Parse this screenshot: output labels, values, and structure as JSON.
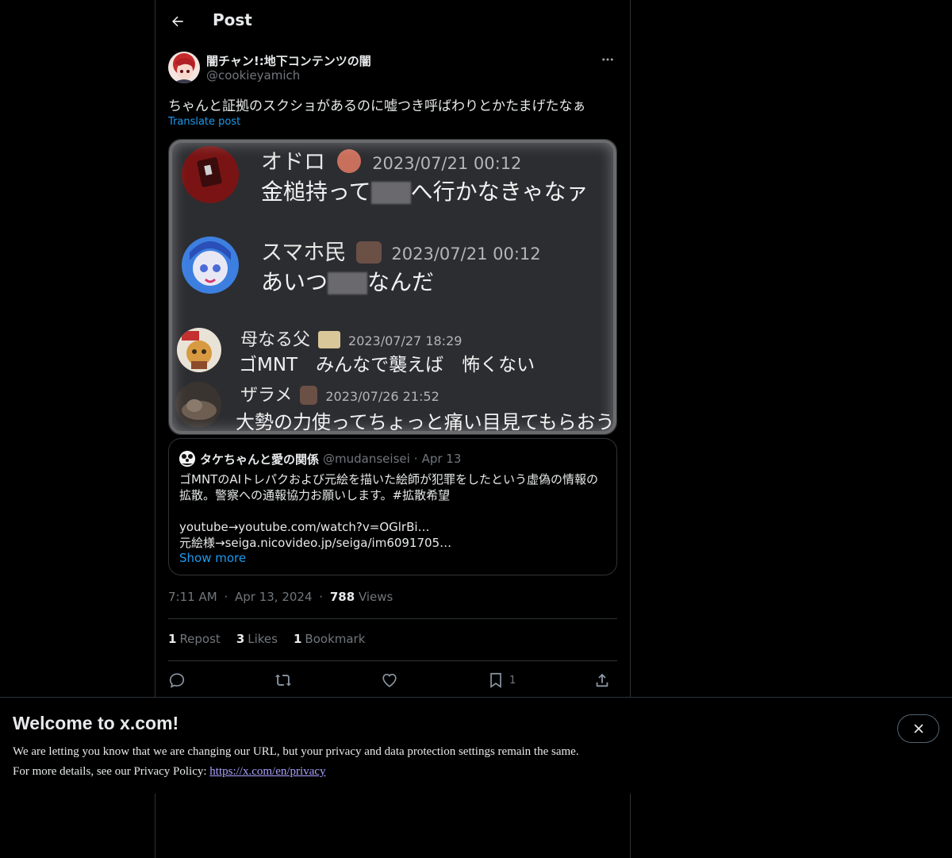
{
  "header": {
    "title": "Post"
  },
  "post": {
    "author_name": "闇チャン!:地下コンテンツの闇",
    "author_handle": "@cookieyamich",
    "text": "ちゃんと証拠のスクショがあるのに嘘つき呼ばわりとかたまげたなぁ",
    "translate_label": "Translate post",
    "media_messages": [
      {
        "name": "オドロ",
        "date": "2023/07/21 00:12",
        "text_before": "金槌持って",
        "text_after": "へ行かなきゃなァ"
      },
      {
        "name": "スマホ民",
        "date": "2023/07/21 00:12",
        "text_before": "あいつ",
        "text_after": "なんだ"
      },
      {
        "name": "母なる父",
        "date": "2023/07/27 18:29",
        "text": "ゴMNT　みんなで襲えば　怖くない"
      },
      {
        "name": "ザラメ",
        "date": "2023/07/26 21:52",
        "text": "大勢の力使ってちょっと痛い目見てもらおう"
      }
    ],
    "quote": {
      "name": "タケちゃんと愛の関係",
      "handle": "@mudanseisei",
      "dot": "·",
      "date": "Apr 13",
      "line1": "ゴMNTのAIトレパクおよび元絵を描いた絵師が犯罪をしたという虚偽の情報の",
      "line2": "拡散。警察への通報協力お願いします。#拡散希望",
      "line3": "youtube→youtube.com/watch?v=OGlrBi…",
      "line4": "元絵様→seiga.nicovideo.jp/seiga/im6091705…",
      "show_more": "Show more"
    },
    "time": "7:11 AM",
    "dot": "·",
    "date": "Apr 13, 2024",
    "views_count": "788",
    "views_label": "Views",
    "reposts_count": "1",
    "reposts_label": "Repost",
    "likes_count": "3",
    "likes_label": "Likes",
    "bookmarks_count": "1",
    "bookmarks_label": "Bookmark",
    "bookmark_action_count": "1"
  },
  "banner": {
    "title": "Welcome to x.com!",
    "line1": "We are letting you know that we are changing our URL, but your privacy and data protection settings remain the same.",
    "line2_prefix": "For more details, see our Privacy Policy: ",
    "link": "https://x.com/en/privacy"
  },
  "icons": {
    "back": "arrow-left-icon",
    "more": "more-horizontal-icon",
    "reply": "reply-icon",
    "repost": "repost-icon",
    "like": "heart-icon",
    "bookmark": "bookmark-icon",
    "share": "share-icon",
    "close": "close-icon"
  },
  "colors": {
    "accent": "#1d9bf0",
    "muted": "#71767b",
    "border": "#2f3336",
    "link_banner": "#a7a3ff"
  }
}
